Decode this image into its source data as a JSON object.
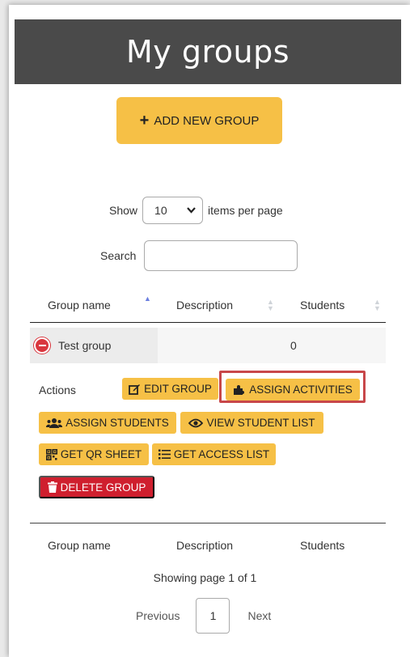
{
  "header": {
    "title": "My groups"
  },
  "toolbar": {
    "add_label": "ADD NEW GROUP"
  },
  "paging_controls": {
    "show_label": "Show",
    "page_size": "10",
    "per_page_label": "items per page"
  },
  "search": {
    "label": "Search",
    "value": ""
  },
  "table": {
    "columns": [
      "Group name",
      "Description",
      "Students"
    ],
    "rows": [
      {
        "name": "Test group",
        "description": "",
        "students": "0"
      }
    ]
  },
  "actions": {
    "label": "Actions",
    "edit": "EDIT GROUP",
    "assign_activities": "ASSIGN ACTIVITIES",
    "assign_students": "ASSIGN STUDENTS",
    "view_students": "VIEW STUDENT LIST",
    "qr_sheet": "GET QR SHEET",
    "access_list": "GET ACCESS LIST",
    "delete": "DELETE GROUP"
  },
  "footer": {
    "showing": "Showing page 1 of 1",
    "previous": "Previous",
    "page": "1",
    "next": "Next"
  },
  "colors": {
    "header_bg": "#4a4a4a",
    "button_yellow": "#f6c046",
    "delete_red": "#cf1f2e",
    "highlight_red": "#c8474a",
    "sort_active": "#6b7fe0"
  }
}
